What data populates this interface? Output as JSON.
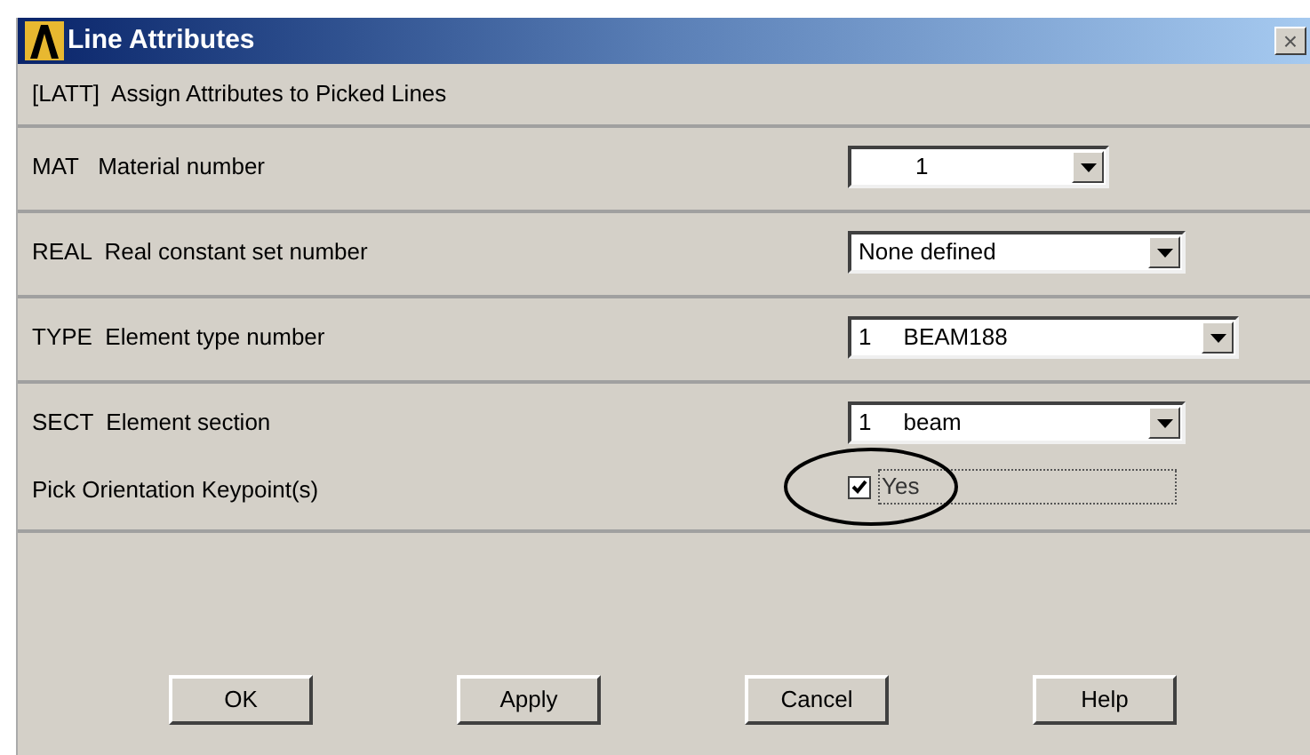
{
  "window": {
    "title": "Line Attributes",
    "close": "×"
  },
  "command": "[LATT]  Assign Attributes to Picked Lines",
  "fields": [
    {
      "kind": "dropdown",
      "label": "MAT   Material number",
      "value": "1"
    },
    {
      "kind": "dropdown",
      "label": "REAL  Real constant set number",
      "value": "None defined"
    },
    {
      "kind": "dropdown",
      "label": "TYPE  Element type number",
      "value": "1     BEAM188"
    },
    {
      "kind": "dropdown",
      "label": "SECT  Element section",
      "value": "1     beam"
    },
    {
      "kind": "checkbox",
      "label": "Pick Orientation Keypoint(s)",
      "value": "Yes",
      "checked": true
    }
  ],
  "buttons": [
    "OK",
    "Apply",
    "Cancel",
    "Help"
  ]
}
